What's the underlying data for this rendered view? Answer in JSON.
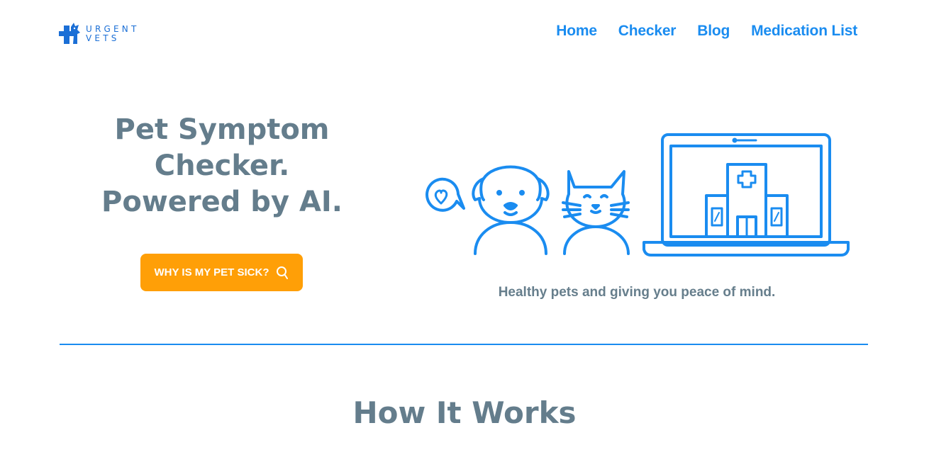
{
  "brand": {
    "logo_line1": "URGENT",
    "logo_line2": "VETS",
    "logo_color": "#1b6fd6"
  },
  "nav": {
    "items": [
      {
        "label": "Home"
      },
      {
        "label": "Checker"
      },
      {
        "label": "Blog"
      },
      {
        "label": "Medication List"
      }
    ],
    "color": "#1a8cf0"
  },
  "hero": {
    "title_lines": [
      "Pet Symptom",
      "Checker.",
      "Powered by AI."
    ],
    "cta_label": "WHY IS MY PET SICK?",
    "cta_icon": "search-icon",
    "cta_color": "#ff9f07",
    "tagline": "Healthy pets and giving you peace of mind.",
    "illustration_icons": [
      "heart-speech-bubble-icon",
      "dog-icon",
      "cat-icon",
      "laptop-hospital-icon"
    ]
  },
  "sections": {
    "how_it_works_title": "How It Works"
  },
  "colors": {
    "heading": "#647d8c",
    "accent": "#1a8cf0"
  }
}
